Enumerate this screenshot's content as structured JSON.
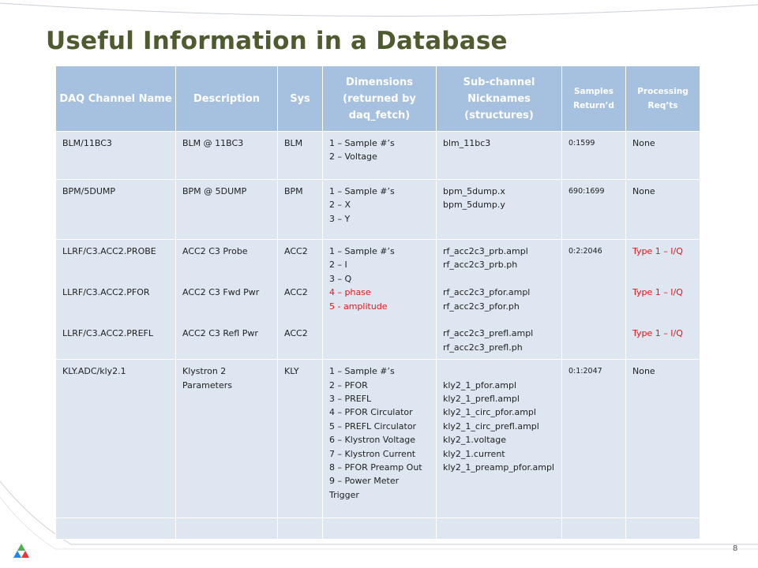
{
  "slide": {
    "title": "Useful Information in a Database",
    "page_number": "8"
  },
  "colors": {
    "title": "#4e5b2e",
    "header_bg": "#a6c0df",
    "cell_bg": "#dee6f1",
    "highlight_text": "#e3171b"
  },
  "table": {
    "headers": [
      "DAQ Channel Name",
      "Description",
      "Sys",
      "Dimensions (returned by daq_fetch)",
      "Sub-channel Nicknames (structures)",
      "Samples Return’d",
      "Processing Req’ts"
    ],
    "rows": [
      {
        "channel": "BLM/11BC3",
        "description": "BLM @ 11BC3",
        "sys": "BLM",
        "dims": [
          "1 – Sample #’s",
          "2 – Voltage"
        ],
        "nicknames": [
          "blm_11bc3"
        ],
        "samples": "0:1599",
        "processing": "None"
      },
      {
        "channel": "BPM/5DUMP",
        "description": "BPM @ 5DUMP",
        "sys": "BPM",
        "dims": [
          "1 – Sample #’s",
          "2 – X",
          "3 – Y"
        ],
        "nicknames": [
          "bpm_5dump.x",
          "bpm_5dump.y"
        ],
        "samples": "690:1699",
        "processing": "None"
      },
      {
        "channels": [
          "LLRF/C3.ACC2.PROBE",
          "LLRF/C3.ACC2.PFOR",
          "LLRF/C3.ACC2.PREFL"
        ],
        "descriptions": [
          "ACC2 C3 Probe",
          "ACC2 C3 Fwd Pwr",
          "ACC2 C3 Refl Pwr"
        ],
        "sys": [
          "ACC2",
          "ACC2",
          "ACC2"
        ],
        "dims": [
          "1 – Sample #’s",
          "2 – I",
          "3 – Q",
          "4 – phase",
          "5 - amplitude"
        ],
        "nicknames": [
          "rf_acc2c3_prb.ampl",
          "rf_acc2c3_prb.ph",
          "rf_acc2c3_pfor.ampl",
          "rf_acc2c3_pfor.ph",
          "rf_acc2c3_prefl.ampl",
          "rf_acc2c3_prefl.ph"
        ],
        "samples": "0:2:2046",
        "processing": [
          "Type 1 – I/Q",
          "Type 1 – I/Q",
          "Type 1 – I/Q"
        ]
      },
      {
        "channel": "KLY.ADC/kly2.1",
        "description": "Klystron 2 Parameters",
        "sys": "KLY",
        "dims": [
          "1 – Sample #’s",
          "2 – PFOR",
          "3 – PREFL",
          "4 – PFOR Circulator",
          "5 – PREFL Circulator",
          "6 – Klystron Voltage",
          "7 – Klystron Current",
          "8 – PFOR Preamp Out",
          "9 – Power Meter Trigger"
        ],
        "nicknames": [
          "kly2_1_pfor.ampl",
          "kly2_1_prefl.ampl",
          "kly2_1_circ_pfor.ampl",
          "kly2_1_circ_prefl.ampl",
          "kly2_1.voltage",
          "kly2_1.current",
          "kly2_1_preamp_pfor.ampl"
        ],
        "samples": "0:1:2047",
        "processing": "None"
      }
    ]
  }
}
